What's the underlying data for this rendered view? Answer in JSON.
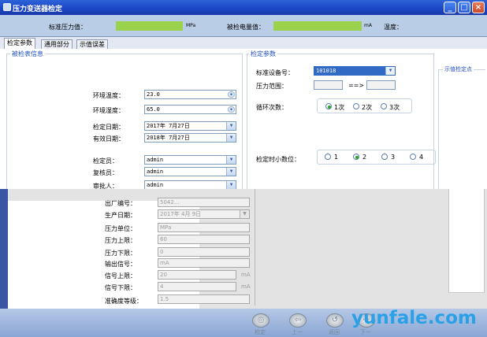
{
  "window": {
    "title": "压力变送器检定",
    "minimize": "_",
    "maximize": "□",
    "close": "×"
  },
  "header": {
    "std_pressure_label": "标准压力值：",
    "pressure_unit": "MPa",
    "measured_label": "被检电量值：",
    "current_unit": "mA",
    "temperature_label": "温度："
  },
  "tabs": [
    "检定参数",
    "通用部分",
    "示值误差"
  ],
  "left_group": {
    "title": "被检表信息",
    "env_temp": {
      "label": "环境温度：",
      "value": "23.0"
    },
    "env_humidity": {
      "label": "环境湿度：",
      "value": "65.0"
    },
    "verify_date": {
      "label": "检定日期：",
      "value": "2017年  7月27日"
    },
    "valid_date": {
      "label": "有效日期：",
      "value": "2018年  7月27日"
    },
    "verifier": {
      "label": "检定员：",
      "value": "admin"
    },
    "checker": {
      "label": "复核员：",
      "value": "admin"
    },
    "approver": {
      "label": "审批人：",
      "value": "admin"
    }
  },
  "right_group": {
    "title": "检定参数",
    "std_device": {
      "label": "标准设备号：",
      "value": "101018"
    },
    "range": {
      "label": "压力范围：",
      "arrow": "==>"
    },
    "cycles": {
      "label": "循环次数：",
      "options": [
        "1次",
        "2次",
        "3次"
      ],
      "selected": 0
    },
    "decimals": {
      "label": "检定时小数位：",
      "options": [
        "1",
        "2",
        "3",
        "4"
      ],
      "selected": 1
    }
  },
  "side_group": {
    "title": "示值检定点"
  },
  "lower": {
    "serial": {
      "label": "出厂编号：",
      "value": "5042..."
    },
    "prod_date": {
      "label": "生产日期：",
      "value": "2017年  4月  9日"
    },
    "pressure_unit": {
      "label": "压力单位：",
      "value": "MPa"
    },
    "upper": {
      "label": "压力上限：",
      "value": "60"
    },
    "lower_limit": {
      "label": "压力下限：",
      "value": "0"
    },
    "output_signal": {
      "label": "输出信号：",
      "value": "mA"
    },
    "signal_upper": {
      "label": "信号上限：",
      "value": "20",
      "unit": "mA"
    },
    "signal_lower": {
      "label": "信号下限：",
      "value": "4",
      "unit": "mA"
    },
    "accuracy": {
      "label": "准确度等级：",
      "value": "1.5"
    }
  },
  "bottom_buttons": [
    {
      "label": "检定",
      "icon": "target-icon"
    },
    {
      "label": "上一",
      "icon": "back-arrow-icon"
    },
    {
      "label": "返回",
      "icon": "return-icon"
    },
    {
      "label": "下一",
      "icon": "next-icon"
    }
  ],
  "watermark": "yunfale.com"
}
